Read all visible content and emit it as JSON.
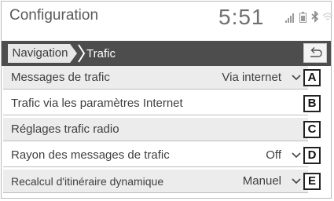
{
  "header": {
    "title": "Configuration",
    "clock": "5:51",
    "status_icons": [
      "signal-icon",
      "battery-icon",
      "bluetooth-icon",
      "wifi-icon"
    ]
  },
  "breadcrumb": {
    "parent": "Navigation",
    "current": "Trafic",
    "back_icon": "return-arrow-icon"
  },
  "rows": [
    {
      "label": "Messages de trafic",
      "value": "Via internet",
      "has_dropdown": true,
      "callout": "A"
    },
    {
      "label": "Trafic via les paramètres Internet",
      "value": "",
      "has_dropdown": false,
      "callout": "B"
    },
    {
      "label": "Réglages trafic radio",
      "value": "",
      "has_dropdown": false,
      "callout": "C"
    },
    {
      "label": "Rayon des messages de trafic",
      "value": "Off",
      "has_dropdown": true,
      "callout": "D"
    },
    {
      "label": "Recalcul d'itinéraire dynamique",
      "value": "Manuel",
      "has_dropdown": true,
      "callout": "E"
    }
  ],
  "colors": {
    "crumb_bar": "#4d4d4d",
    "row_shade": "#ececec"
  }
}
